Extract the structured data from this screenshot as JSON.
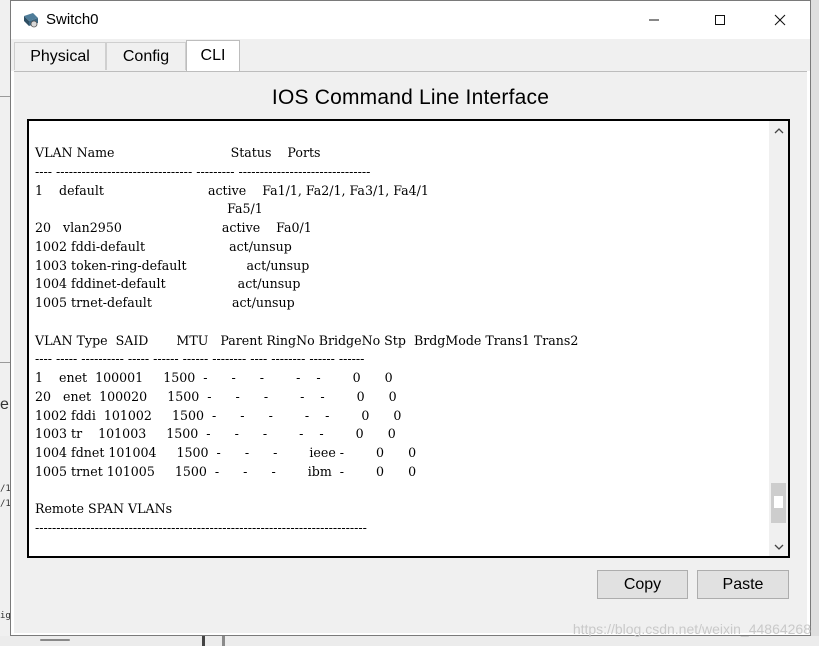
{
  "window": {
    "title": "Switch0"
  },
  "tabs": [
    {
      "label": "Physical",
      "active": false
    },
    {
      "label": "Config",
      "active": false
    },
    {
      "label": "CLI",
      "active": true
    }
  ],
  "cli": {
    "heading": "IOS Command Line Interface",
    "lines": [
      "VLAN Name                             Status    Ports",
      "---- -------------------------------- --------- -------------------------------",
      "1    default                          active    Fa1/1, Fa2/1, Fa3/1, Fa4/1",
      "                                                Fa5/1",
      "20   vlan2950                         active    Fa0/1",
      "1002 fddi-default                     act/unsup",
      "1003 token-ring-default               act/unsup",
      "1004 fddinet-default                  act/unsup",
      "1005 trnet-default                    act/unsup",
      "",
      "VLAN Type  SAID       MTU   Parent RingNo BridgeNo Stp  BrdgMode Trans1 Trans2",
      "---- ----- ---------- ----- ------ ------ -------- ---- -------- ------ ------",
      "1    enet  100001     1500  -      -      -        -    -        0      0",
      "20   enet  100020     1500  -      -      -        -    -        0      0",
      "1002 fddi  101002     1500  -      -      -        -    -        0      0",
      "1003 tr    101003     1500  -      -      -        -    -        0      0",
      "1004 fdnet 101004     1500  -      -      -        ieee -        0      0",
      "1005 trnet 101005     1500  -      -      -        ibm  -        0      0",
      "",
      "Remote SPAN VLANs",
      "------------------------------------------------------------------------------"
    ]
  },
  "buttons": {
    "copy": "Copy",
    "paste": "Paste"
  },
  "background": {
    "left_fragment": "e",
    "frag_a": "/1",
    "frag_b": "/1",
    "frag_c": "ig"
  },
  "watermark": "https://blog.csdn.net/weixin_44864268",
  "colors": {
    "window_bg": "#ffffff",
    "panel_bg": "#f0f0f0",
    "terminal_border": "#000000",
    "button_bg": "#e1e1e1"
  }
}
